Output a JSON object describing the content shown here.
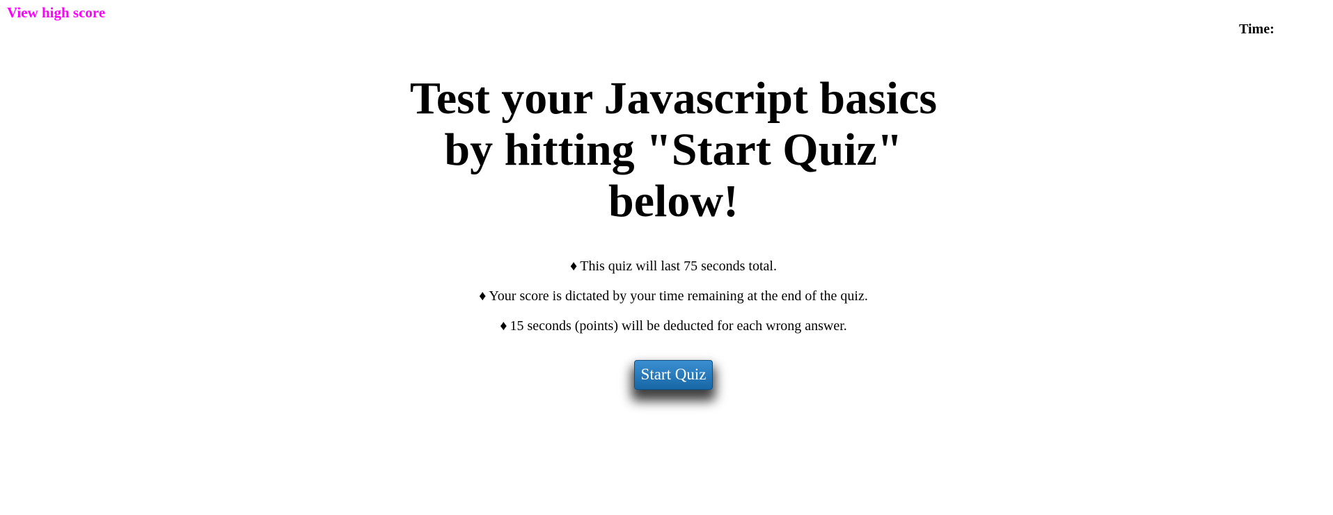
{
  "nav": {
    "high_score_label": "View high score",
    "link_color": "#ff00ff"
  },
  "timer": {
    "label": "Time:",
    "value": ""
  },
  "intro": {
    "title": "Test your Javascript basics by hitting \"Start Quiz\" below!",
    "bullet_icon": "diamond-suit-icon",
    "bullet_glyph": "♦",
    "rules": [
      "This quiz will last 75 seconds total.",
      "Your score is dictated by your time remaining at the end of the quiz.",
      "15 seconds (points) will be deducted for each wrong answer."
    ],
    "start_label": "Start Quiz",
    "button_color": "#1f74b8"
  }
}
